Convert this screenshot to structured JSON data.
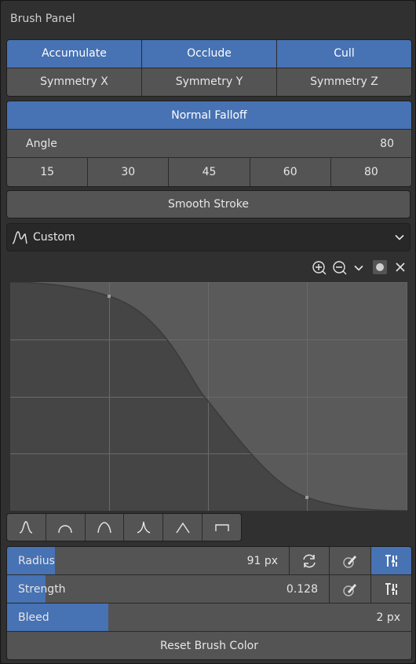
{
  "panel": {
    "title": "Brush Panel"
  },
  "modes": [
    "Accumulate",
    "Occlude",
    "Cull"
  ],
  "symmetry": [
    "Symmetry X",
    "Symmetry Y",
    "Symmetry Z"
  ],
  "normal_falloff": "Normal Falloff",
  "angle": {
    "label": "Angle",
    "value": "80",
    "presets": [
      "15",
      "30",
      "45",
      "60",
      "80"
    ]
  },
  "smooth_stroke": "Smooth Stroke",
  "falloff": {
    "selected": "Custom"
  },
  "radius": {
    "label": "Radius",
    "value": "91 px",
    "fill_fraction": 0.11
  },
  "strength": {
    "label": "Strength",
    "value": "0.128",
    "fill_fraction": 0.1
  },
  "bleed": {
    "label": "Bleed",
    "value": "2 px",
    "fill_fraction": 0.25
  },
  "reset_brush_color": "Reset Brush Color",
  "colors": {
    "accent": "#4772b3",
    "button": "#545454",
    "panel": "#303030"
  }
}
